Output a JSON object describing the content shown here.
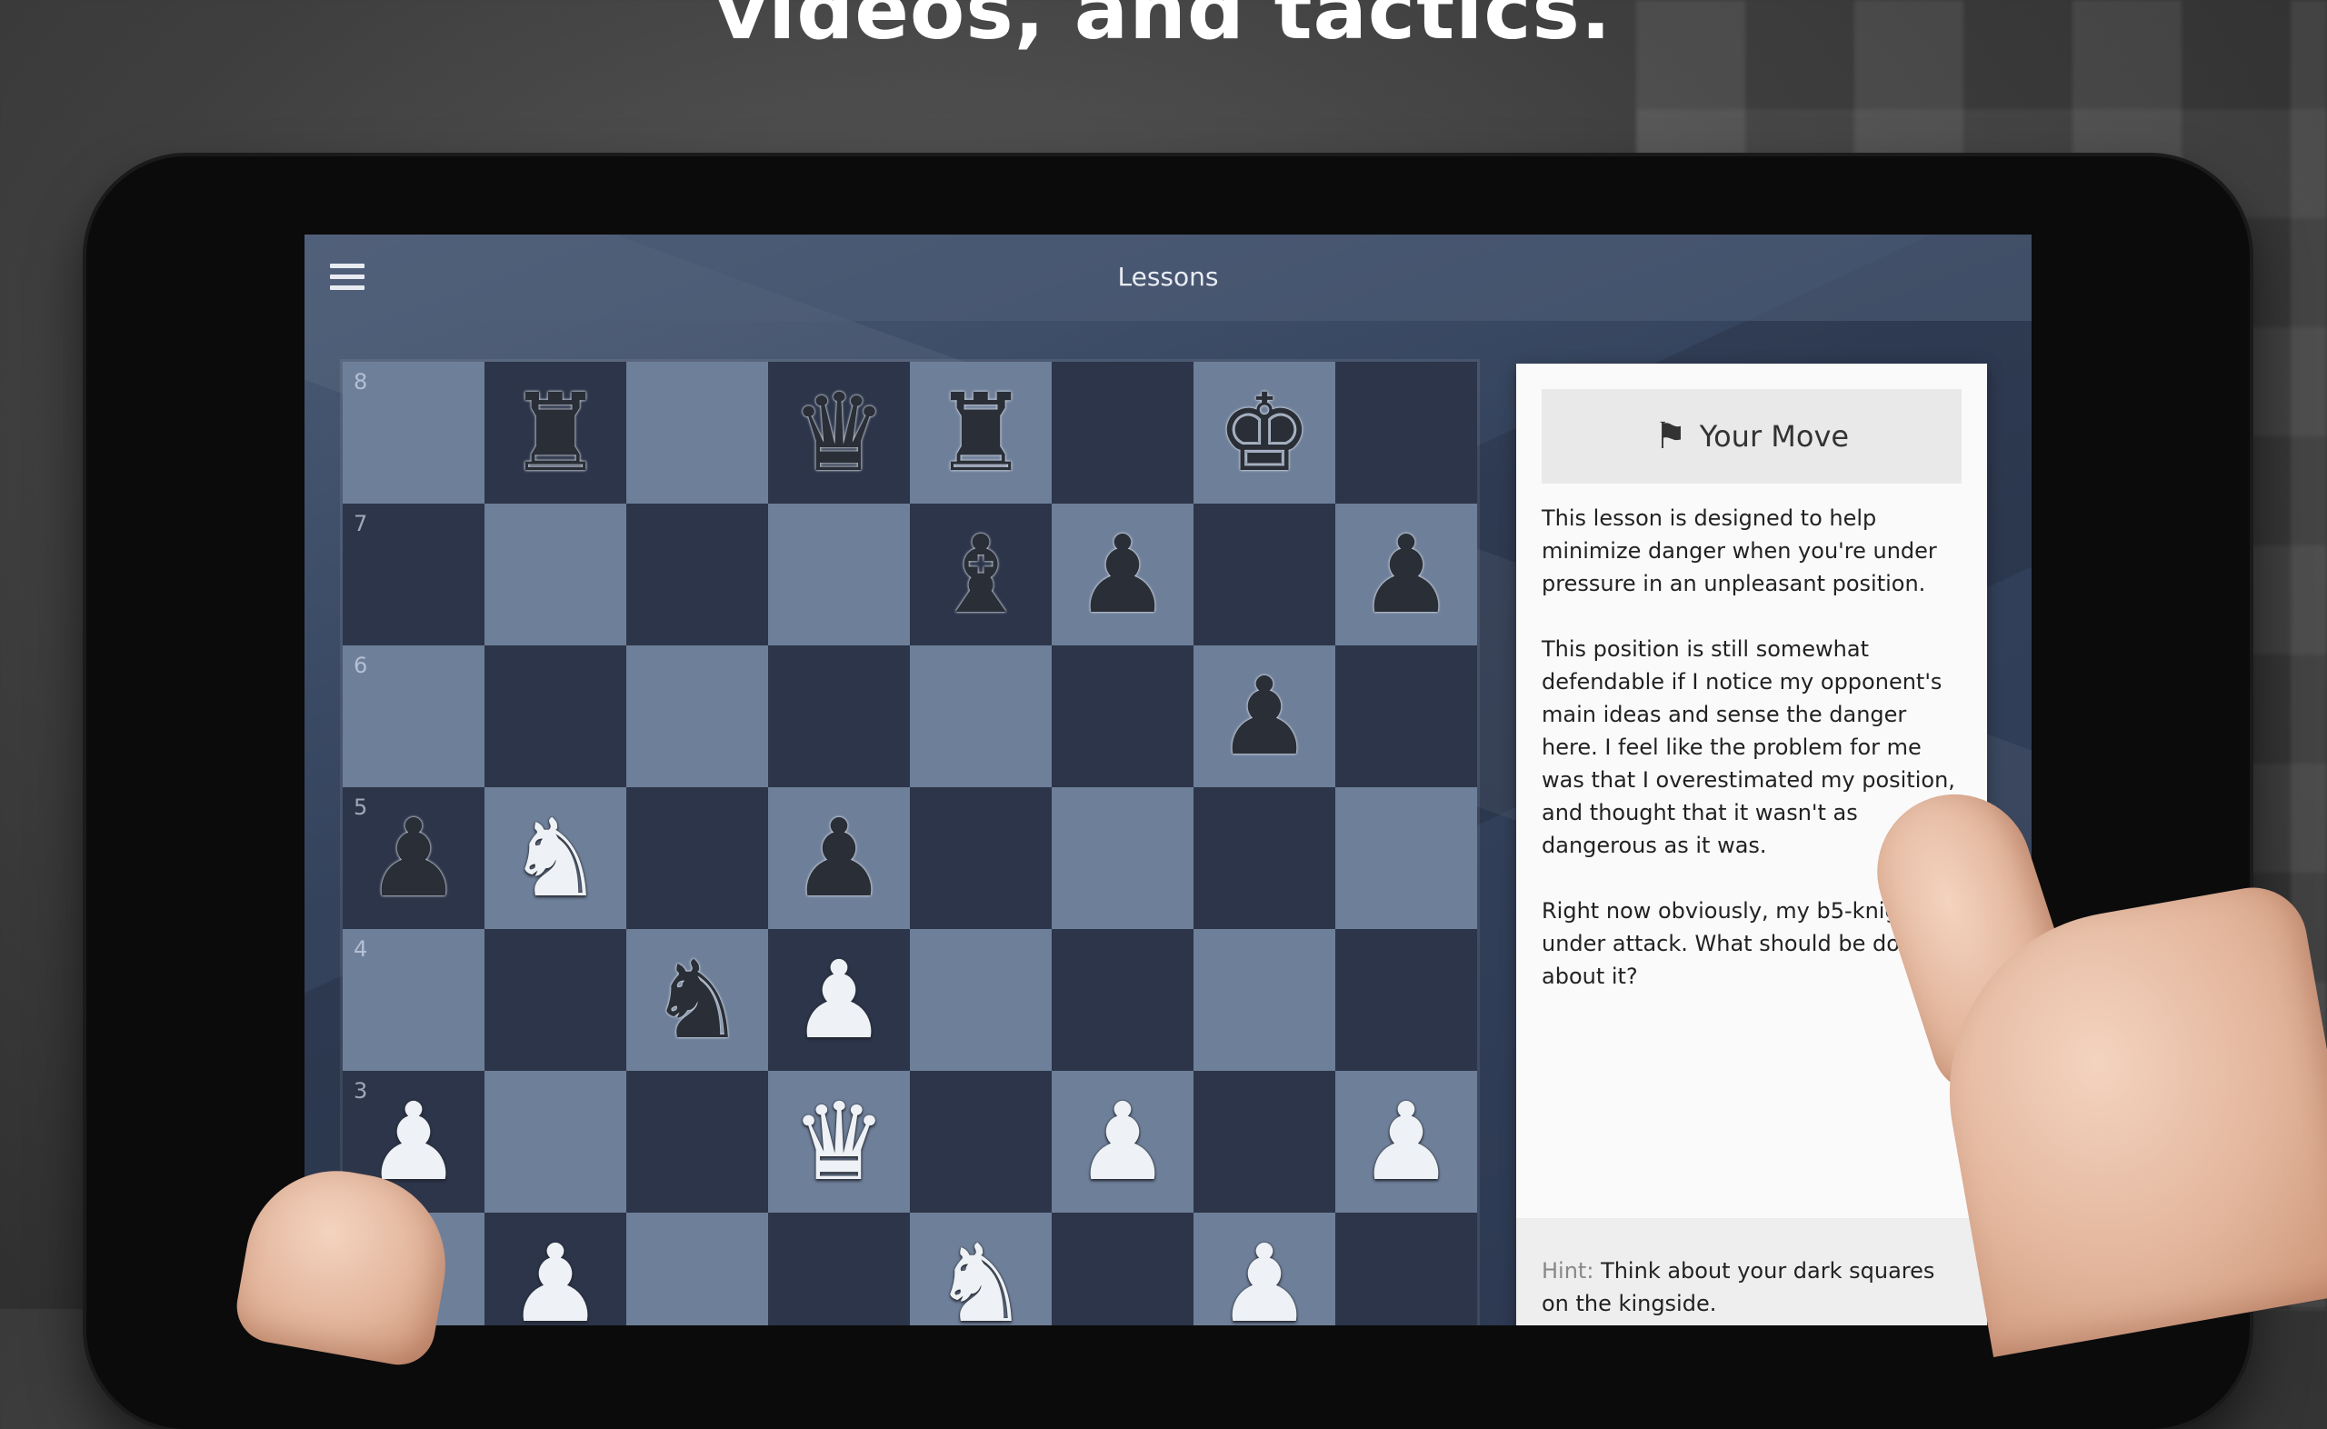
{
  "headline": "videos, and tactics.",
  "app": {
    "title": "Lessons",
    "menu_icon": "hamburger-menu-icon"
  },
  "board": {
    "ranks": [
      "8",
      "7",
      "6",
      "5",
      "4",
      "3",
      "2"
    ],
    "squares": [
      [
        "",
        "r",
        "",
        "q",
        "r",
        "",
        "k",
        ""
      ],
      [
        "",
        "",
        "",
        "",
        "b",
        "p",
        "",
        "p"
      ],
      [
        "",
        "",
        "",
        "",
        "",
        "",
        "p",
        ""
      ],
      [
        "p",
        "N",
        "",
        "p",
        "",
        "",
        "",
        ""
      ],
      [
        "",
        "",
        "n",
        "P",
        "",
        "",
        "",
        ""
      ],
      [
        "P",
        "",
        "",
        "Q",
        "",
        "P",
        "",
        "P"
      ],
      [
        "",
        "P",
        "",
        "",
        "N",
        "",
        "P",
        ""
      ]
    ]
  },
  "panel": {
    "move_label": "Your Move",
    "move_icon": "flag-icon",
    "paragraphs": [
      "This lesson is designed to help minimize danger when you're under pressure in an unpleasant position.",
      "This position is still somewhat defendable if I notice my opponent's main ideas and sense the danger here. I feel like the problem for me was that I overestimated my position, and thought that it wasn't as dangerous as it was.",
      "Right now obviously, my b5-knight is under attack. What should be done about it?"
    ],
    "hint_label": "Hint:",
    "hint_text": "Think about your dark squares on the kingside."
  },
  "colors": {
    "light_square": "#6e7f99",
    "dark_square": "#2c3549",
    "panel_bg": "#fafafa"
  }
}
